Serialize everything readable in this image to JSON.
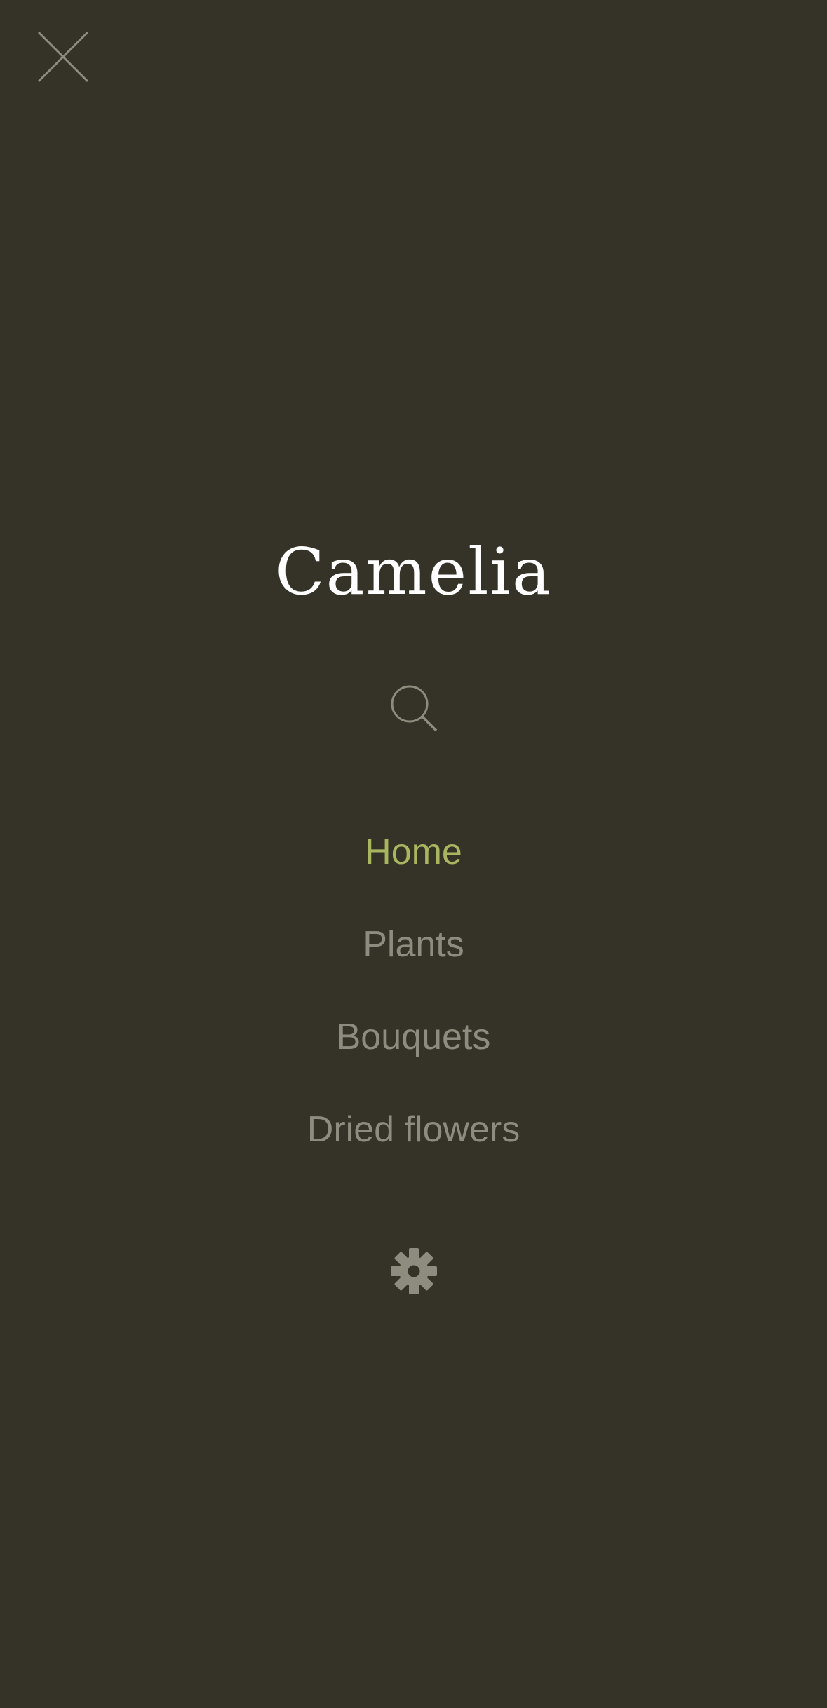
{
  "theme": {
    "background": "#353327",
    "brand_color": "#ffffff",
    "active_color": "#a9b65f",
    "muted_color": "#8e8c7e"
  },
  "header": {
    "close_icon": "close-icon"
  },
  "brand": {
    "title": "Camelia"
  },
  "search": {
    "icon": "search-icon"
  },
  "nav": {
    "active_index": 0,
    "items": [
      {
        "label": "Home"
      },
      {
        "label": "Plants"
      },
      {
        "label": "Bouquets"
      },
      {
        "label": "Dried flowers"
      }
    ]
  },
  "footer": {
    "settings_icon": "gear-icon"
  }
}
